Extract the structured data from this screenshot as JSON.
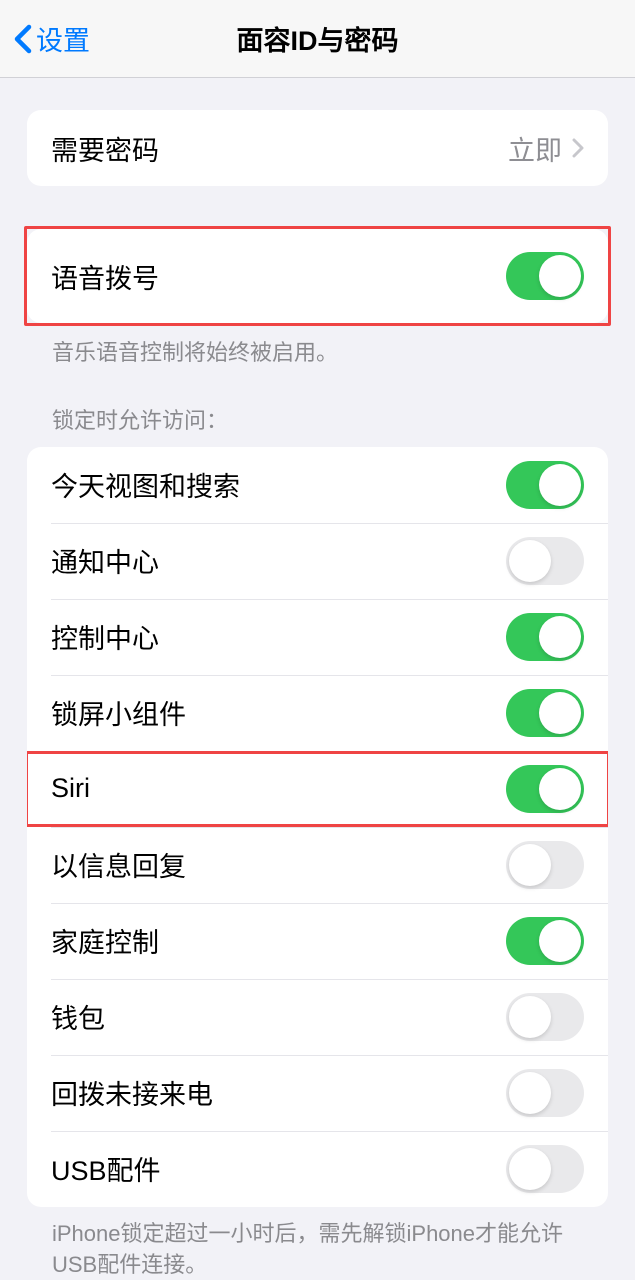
{
  "header": {
    "back_label": "设置",
    "title": "面容ID与密码"
  },
  "require_passcode": {
    "label": "需要密码",
    "value": "立即"
  },
  "voice_dial": {
    "label": "语音拨号",
    "footer": "音乐语音控制将始终被启用。",
    "enabled": true
  },
  "lock_access": {
    "header": "锁定时允许访问：",
    "items": [
      {
        "label": "今天视图和搜索",
        "enabled": true
      },
      {
        "label": "通知中心",
        "enabled": false
      },
      {
        "label": "控制中心",
        "enabled": true
      },
      {
        "label": "锁屏小组件",
        "enabled": true
      },
      {
        "label": "Siri",
        "enabled": true
      },
      {
        "label": "以信息回复",
        "enabled": false
      },
      {
        "label": "家庭控制",
        "enabled": true
      },
      {
        "label": "钱包",
        "enabled": false
      },
      {
        "label": "回拨未接来电",
        "enabled": false
      },
      {
        "label": "USB配件",
        "enabled": false
      }
    ],
    "footer": "iPhone锁定超过一小时后，需先解锁iPhone才能允许USB配件连接。"
  }
}
